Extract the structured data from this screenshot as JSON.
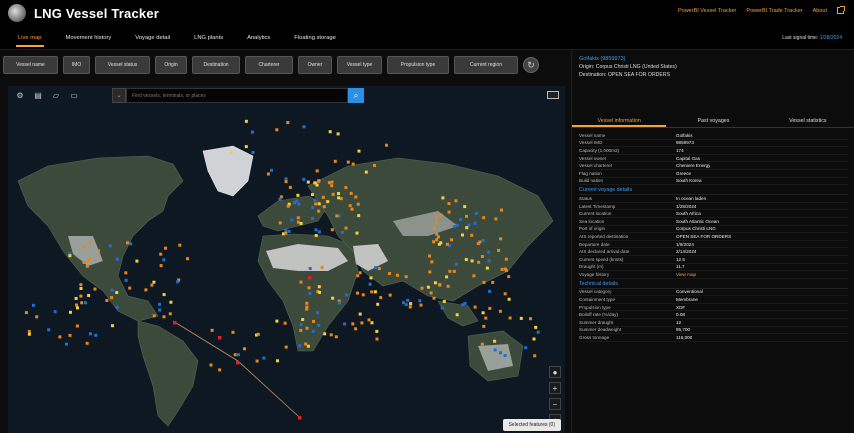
{
  "header": {
    "title": "LNG Vessel Tracker",
    "links": [
      "PowerBI Vessel Tracker",
      "PowerBI Trade Tracker",
      "About"
    ]
  },
  "nav": {
    "items": [
      "Live map",
      "Movement history",
      "Voyage detail",
      "LNG plants",
      "Analytics",
      "Floating storage"
    ],
    "active": "Live map",
    "last_update_label": "Last signal time:",
    "last_update_value": "1/28/2024"
  },
  "filters": [
    "Vessel name",
    "IMO",
    "Vessel status",
    "Origin",
    "Destination",
    "Charterer",
    "Owner",
    "Vessel type",
    "Propulsion type",
    "Current region"
  ],
  "map": {
    "search_placeholder": "Find vessels, terminals, or places",
    "legend_label": "Selected features (0)"
  },
  "vessel": {
    "name": "Golfakis (9859973)",
    "origin": "Origin: Corpus Christi LNG (United States)",
    "destination": "Destination: OPEN SEA FOR ORDERS"
  },
  "tabs": [
    "Vessel information",
    "Past voyages",
    "Vessel statistics"
  ],
  "details": {
    "basic": [
      {
        "k": "Vessel name",
        "v": "Golfakis"
      },
      {
        "k": "Vessel IMO",
        "v": "9859973"
      },
      {
        "k": "Capacity (1,000m3)",
        "v": "174"
      },
      {
        "k": "Vessel owner",
        "v": "Capital Gas"
      },
      {
        "k": "Vessel charterer",
        "v": "Cheniere Energy"
      },
      {
        "k": "Flag nation",
        "v": "Greece"
      },
      {
        "k": "Build nation",
        "v": "South Korea"
      }
    ],
    "voyage_title": "Current voyage details",
    "voyage": [
      {
        "k": "Status",
        "v": "In ocean laden"
      },
      {
        "k": "Latest Timestamp",
        "v": "1/28/2024"
      },
      {
        "k": "Current location",
        "v": "South Africa"
      },
      {
        "k": "Sea location",
        "v": "South Atlantic Ocean"
      },
      {
        "k": "Port of origin",
        "v": "Corpus Christi LNG"
      },
      {
        "k": "AIS reported destination",
        "v": "OPEN SEA FOR ORDERS"
      },
      {
        "k": "Departure date",
        "v": "1/8/2024"
      },
      {
        "k": "AIS declared arrival date",
        "v": "2/14/2024"
      },
      {
        "k": "Current speed (knots)",
        "v": "12.5"
      },
      {
        "k": "Draught (m)",
        "v": "11.7"
      }
    ],
    "voyage_history_label": "Voyage history",
    "voyage_history_value": "View map",
    "tech_title": "Technical details",
    "tech": [
      {
        "k": "Vessel category",
        "v": "Conventional"
      },
      {
        "k": "Containment type",
        "v": "Membrane"
      },
      {
        "k": "Propulsion type",
        "v": "XDF"
      },
      {
        "k": "Boiloff rate (%/day)",
        "v": "0.08"
      },
      {
        "k": "Summer draught",
        "v": "12"
      },
      {
        "k": "Summer deadweight",
        "v": "95,700"
      },
      {
        "k": "Gross tonnage",
        "v": "116,000"
      }
    ]
  },
  "colors": {
    "accent": "#f2a33a",
    "link": "#3b9df2",
    "laden": "#e8861c",
    "ballast": "#1f6fd6",
    "idle": "#f2d13a",
    "selected": "#e02020"
  }
}
